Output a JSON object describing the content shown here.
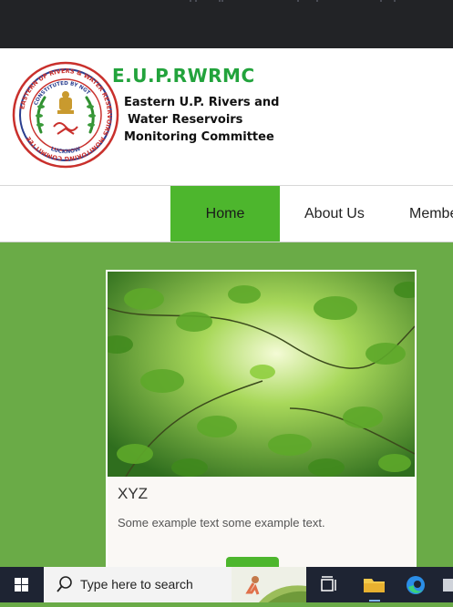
{
  "header": {
    "brand": "E.U.P.RWRMC",
    "subtitle_lines": [
      "Eastern U.P. Rivers and",
      "Water Reservoirs",
      "Monitoring Committee"
    ],
    "logo_text": {
      "ring": "EASTERN UP RIVERS & WATER RESERVOIRS MONITORING COMMITTEE",
      "inner": "CONSTITUTED BY NGT",
      "order": "Order dt. 22.08.2018, In OA No. 115/2014",
      "bottom": "LUCKNOW"
    }
  },
  "nav": {
    "items": [
      {
        "label": "Home",
        "active": true
      },
      {
        "label": "About Us",
        "active": false
      },
      {
        "label": "Members",
        "active": false
      }
    ]
  },
  "card": {
    "title": "XYZ",
    "text": "Some example text some example text."
  },
  "taskbar": {
    "search_placeholder": "Type here to search"
  },
  "colors": {
    "brand_green": "#22a33c",
    "nav_active": "#4db62d",
    "page_background": "#6aab47",
    "taskbar": "#1e2433"
  }
}
